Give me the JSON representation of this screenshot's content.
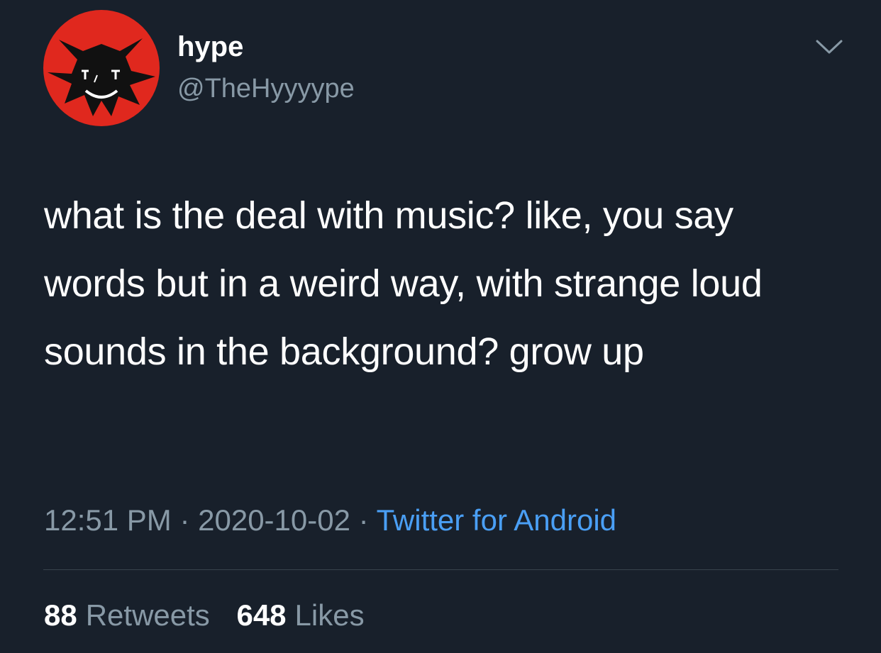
{
  "user": {
    "display_name": "hype",
    "handle": "@TheHyyyype",
    "avatar_icon": "red-devil-avatar-icon"
  },
  "menu": {
    "icon": "chevron-down-icon"
  },
  "tweet": {
    "text": "what is the deal with music? like, you say words but in a weird way, with strange loud sounds in the background? grow up",
    "time": "12:51 PM",
    "date": "2020-10-02",
    "separator": "·",
    "source": "Twitter for Android"
  },
  "stats": {
    "retweets_count": "88",
    "retweets_label": "Retweets",
    "likes_count": "648",
    "likes_label": "Likes"
  },
  "colors": {
    "background": "#18202b",
    "text_primary": "#ffffff",
    "text_secondary": "#8899a6",
    "link": "#4a9ff5",
    "divider": "#38444d",
    "avatar_red": "#e0281e"
  }
}
